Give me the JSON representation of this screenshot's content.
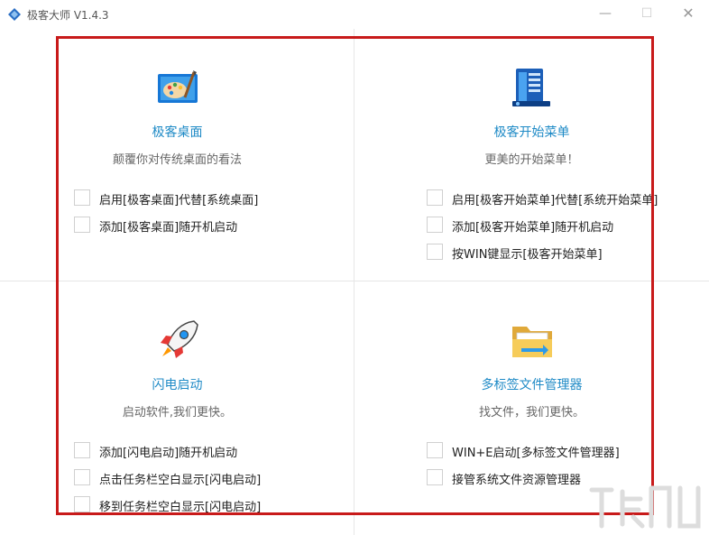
{
  "window": {
    "title": "极客大师 V1.4.3",
    "controls": [
      "—",
      "☐",
      "✕"
    ]
  },
  "panels": [
    {
      "title": "极客桌面",
      "desc": "颠覆你对传统桌面的看法",
      "options": [
        "启用[极客桌面]代替[系统桌面]",
        "添加[极客桌面]随开机启动"
      ]
    },
    {
      "title": "极客开始菜单",
      "desc": "更美的开始菜单！",
      "options": [
        "启用[极客开始菜单]代替[系统开始菜单]",
        "添加[极客开始菜单]随开机启动",
        "按WIN键显示[极客开始菜单]"
      ]
    },
    {
      "title": "闪电启动",
      "desc": "启动软件,我们更快。",
      "options": [
        "添加[闪电启动]随开机启动",
        "点击任务栏空白显示[闪电启动]",
        "移到任务栏空白显示[闪电启动]"
      ]
    },
    {
      "title": "多标签文件管理器",
      "desc": "找文件，我们更快。",
      "options": [
        "WIN+E启动[多标签文件管理器]",
        "接管系统文件资源管理器"
      ]
    }
  ],
  "icons": {
    "app": "app-diamond-icon",
    "desktop": "paint-palette-icon",
    "start": "start-menu-icon",
    "flash": "rocket-icon",
    "files": "folder-icon"
  },
  "colors": {
    "accent": "#1e8ac6",
    "highlight": "#c81a1a"
  }
}
